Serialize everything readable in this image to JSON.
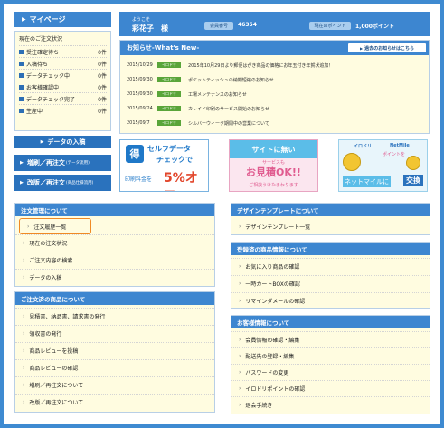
{
  "mypage": {
    "title": "マイページ"
  },
  "status": {
    "title": "現在のご注文状況",
    "rows": [
      {
        "label": "受注確定待ち",
        "count": "0件"
      },
      {
        "label": "入稿待ち",
        "count": "0件"
      },
      {
        "label": "データチェック中",
        "count": "0件"
      },
      {
        "label": "お客様確認中",
        "count": "0件"
      },
      {
        "label": "データチェック完了",
        "count": "0件"
      },
      {
        "label": "生産中",
        "count": "0件"
      }
    ]
  },
  "side_buttons": {
    "data_in": "データの入稿",
    "reorder_main": "増刷／再注文",
    "reorder_small": "(データ流用)",
    "revise_main": "改版／再注文",
    "revise_small": "(商品仕様流用)"
  },
  "user": {
    "welcome": "ようこそ",
    "name": "彩花子　様",
    "member_label": "会員番号",
    "member_value": "46354",
    "points_label": "現在のポイント",
    "points_value": "1,000ポイント"
  },
  "news": {
    "title": "お知らせ-What's New-",
    "past_link": "過去のお知らせはこちら",
    "items": [
      {
        "date": "2015/10/29",
        "tag": "イロドリ",
        "text": "2015年10月29日より郵便はがき商品の価格にお年玉付き年賀状追加！"
      },
      {
        "date": "2015/09/30",
        "tag": "イロドリ",
        "text": "ポケットティッシュの納期短縮のお知らせ"
      },
      {
        "date": "2015/09/30",
        "tag": "イロドリ",
        "text": "工場メンテナンスのお知らせ"
      },
      {
        "date": "2015/09/24",
        "tag": "イロドリ",
        "text": "カレイド印刷のサービス開始のお知らせ"
      },
      {
        "date": "2015/09/7",
        "tag": "イロドリ",
        "text": "シルバーウィーク期間中の営業について"
      }
    ]
  },
  "banners": {
    "check": {
      "toku": "得",
      "line1": "セルフデータ",
      "line2": "チェックで",
      "line3": "印刷料金を",
      "pct": "5%オフ"
    },
    "quote": {
      "top": "サイトに無い",
      "service": "サービスも",
      "ok": "お見積OK!!",
      "bottom": "ご相談うけたまわります"
    },
    "netmile": {
      "logo1": "イロドリ",
      "logo2": "NetMile",
      "points": "ポイントを",
      "net": "ネットマイルに",
      "exchange": "交換"
    }
  },
  "menus": {
    "order_mgmt": {
      "title": "注文管理について",
      "items": [
        "注文履歴一覧",
        "現在の注文状況",
        "ご注文内容の検索",
        "データの入稿"
      ]
    },
    "ordered_products": {
      "title": "ご注文済の商品について",
      "items": [
        "見積書、納品書、請求書の発行",
        "領収書の発行",
        "商品レビューを投稿",
        "商品レビューの確認",
        "増刷／再注文について",
        "改版／再注文について"
      ]
    },
    "design_templates": {
      "title": "デザインテンプレートについて",
      "items": [
        "デザインテンプレート一覧"
      ]
    },
    "registered_products": {
      "title": "登録済の商品情報について",
      "items": [
        "お気に入り商品の確認",
        "一時カートBOXの確認",
        "リマインダメールの確認"
      ]
    },
    "customer_info": {
      "title": "お客様情報について",
      "items": [
        "会員情報の確認・編集",
        "配送先の登録・編集",
        "パスワードの変更",
        "イロドリポイントの確認",
        "退会手続き"
      ]
    }
  }
}
